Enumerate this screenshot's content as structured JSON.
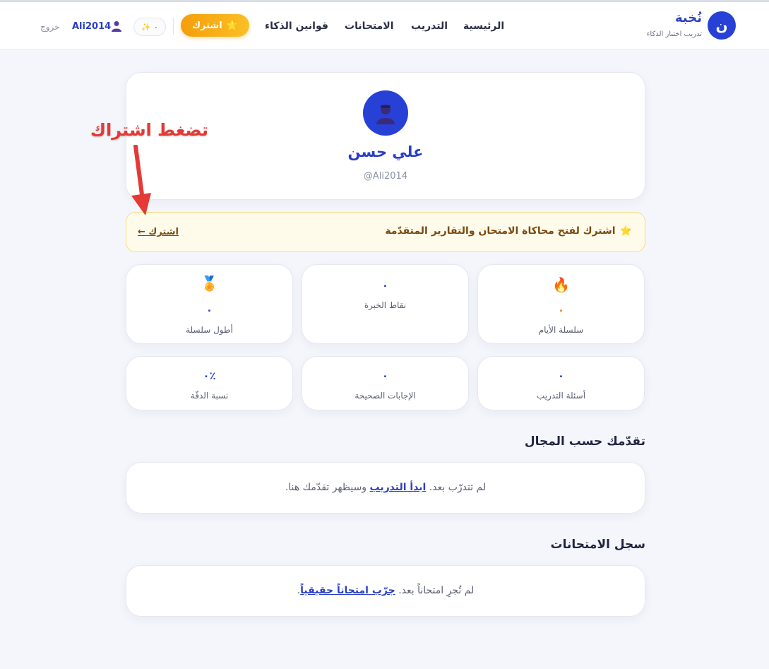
{
  "header": {
    "brand": {
      "logo_letter": "ن",
      "name": "نُخبة",
      "subtitle": "تدريب اختبار الذكاء"
    },
    "nav": [
      "الرئيسية",
      "التدريب",
      "الامتحانات",
      "قوانين الذكاء"
    ],
    "subscribe_label": "اشترك",
    "subscribe_icon": "star-icon",
    "xp_value": "٠",
    "username": "Ali2014",
    "logout_label": "خروج"
  },
  "profile": {
    "name": "علي حسن",
    "handle": "@Ali2014"
  },
  "banner": {
    "text": "اشترك لفتح محاكاة الامتحان والتقارير المتقدّمة",
    "link": "اشترك ←"
  },
  "stats": {
    "streak": {
      "icon": "fire-icon",
      "value": "٠",
      "label": "سلسلة الأيام"
    },
    "xp": {
      "value": "٠",
      "label": "نقاط الخبرة"
    },
    "longest": {
      "icon": "medal-icon",
      "value": "٠",
      "label": "أطول سلسلة"
    },
    "questions": {
      "value": "٠",
      "label": "أسئلة التدريب"
    },
    "correct": {
      "value": "٠",
      "label": "الإجابات الصحيحة"
    },
    "accuracy": {
      "value": "٠٪",
      "label": "نسبة الدقّة"
    }
  },
  "progress": {
    "title": "تقدّمك حسب المجال",
    "empty_before": "لم تتدرّب بعد.",
    "empty_link": "ابدأ التدريب",
    "empty_after": "وسيظهر تقدّمك هنا."
  },
  "exams": {
    "title": "سجل الامتحانات",
    "empty_before": "لم تُجرِ امتحاناً بعد.",
    "empty_link": "جرّب امتحاناً حقيقياً",
    "empty_after": "."
  },
  "annotation": {
    "text": "تضغط اشتراك"
  },
  "colors": {
    "primary": "#2741d6",
    "accent": "#f59e0b",
    "annotation": "#e53935",
    "streak": "#f57c00"
  }
}
